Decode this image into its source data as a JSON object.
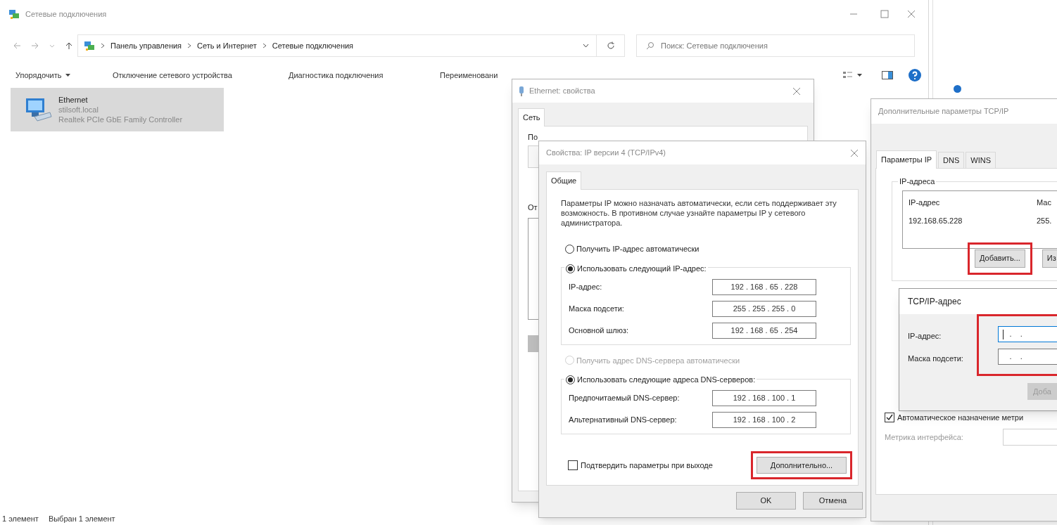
{
  "explorer": {
    "title": "Сетевые подключения",
    "breadcrumb": [
      "Панель управления",
      "Сеть и Интернет",
      "Сетевые подключения"
    ],
    "search": {
      "placeholder": "Поиск: Сетевые подключения"
    },
    "toolbar": [
      {
        "label": "Упорядочить",
        "kind": "menu"
      },
      {
        "label": "Отключение сетевого устройства",
        "kind": "button"
      },
      {
        "label": "Диагностика подключения",
        "kind": "button"
      },
      {
        "label": "Переименовани",
        "kind": "button"
      }
    ],
    "connections": [
      {
        "name": "Ethernet",
        "domain": "stilsoft.local",
        "adapter": "Realtek PCIe GbE Family Controller",
        "selected": true
      }
    ],
    "status_bar": [
      "1 элемент",
      "Выбран 1 элемент"
    ]
  },
  "ethernet_dialog": {
    "title": "Ethernet: свойства",
    "tabs": [
      {
        "label": "Сеть",
        "selected": true
      }
    ],
    "labels": [
      "По",
      "От"
    ]
  },
  "ipv4_dialog": {
    "title": "Свойства: IP версии 4 (TCP/IPv4)",
    "tabs": [
      {
        "label": "Общие",
        "selected": true
      }
    ],
    "intro": "Параметры IP можно назначать автоматически, если сеть поддерживает эту возможность. В противном случае узнайте параметры IP у сетевого администратора.",
    "ip_options": [
      {
        "label": "Получить IP-адрес автоматически",
        "selected": false,
        "disabled": false
      },
      {
        "label": "Использовать следующий IP-адрес:",
        "selected": true,
        "disabled": false
      }
    ],
    "ip_fields": [
      {
        "label": "IP-адрес:",
        "value": "192 . 168 . 65 . 228"
      },
      {
        "label": "Маска подсети:",
        "value": "255 . 255 . 255 . 0"
      },
      {
        "label": "Основной шлюз:",
        "value": "192 . 168 . 65 . 254"
      }
    ],
    "dns_options": [
      {
        "label": "Получить адрес DNS-сервера автоматически",
        "selected": false,
        "disabled": true
      },
      {
        "label": "Использовать следующие адреса DNS-серверов:",
        "selected": true,
        "disabled": false
      }
    ],
    "dns_fields": [
      {
        "label": "Предпочитаемый DNS-сервер:",
        "value": "192 . 168 . 100 . 1"
      },
      {
        "label": "Альтернативный DNS-сервер:",
        "value": "192 . 168 . 100 . 2"
      }
    ],
    "confirm": {
      "label": "Подтвердить параметры при выходе",
      "checked": false
    },
    "advanced_button": {
      "label": "Дополнительно...",
      "highlighted": true
    },
    "buttons": [
      "OK",
      "Отмена"
    ]
  },
  "advanced_dialog": {
    "title": "Дополнительные параметры TCP/IP",
    "tabs": [
      {
        "label": "Параметры IP",
        "selected": true
      },
      {
        "label": "DNS",
        "selected": false
      },
      {
        "label": "WINS",
        "selected": false
      }
    ],
    "group_title": "IP-адреса",
    "columns": [
      "IP-адрес",
      "Мас"
    ],
    "rows": [
      [
        "192.168.65.228",
        "255."
      ]
    ],
    "buttons": [
      {
        "label": "Добавить...",
        "highlighted": true
      },
      {
        "label": "Из",
        "highlighted": false
      }
    ],
    "auto_metric": {
      "label": "Автоматическое назначение метри",
      "checked": true
    },
    "metric": {
      "label": "Метрика интерфейса:",
      "disabled": true
    }
  },
  "tcpip_dialog": {
    "title": "TCP/IP-адрес",
    "fields": [
      {
        "label": "IP-адрес:",
        "value": ".    .",
        "focused": true
      },
      {
        "label": "Маска подсети:",
        "value": ".    .",
        "focused": false
      }
    ],
    "fields_highlighted": true,
    "button": {
      "label": "Доба",
      "disabled": true
    }
  }
}
